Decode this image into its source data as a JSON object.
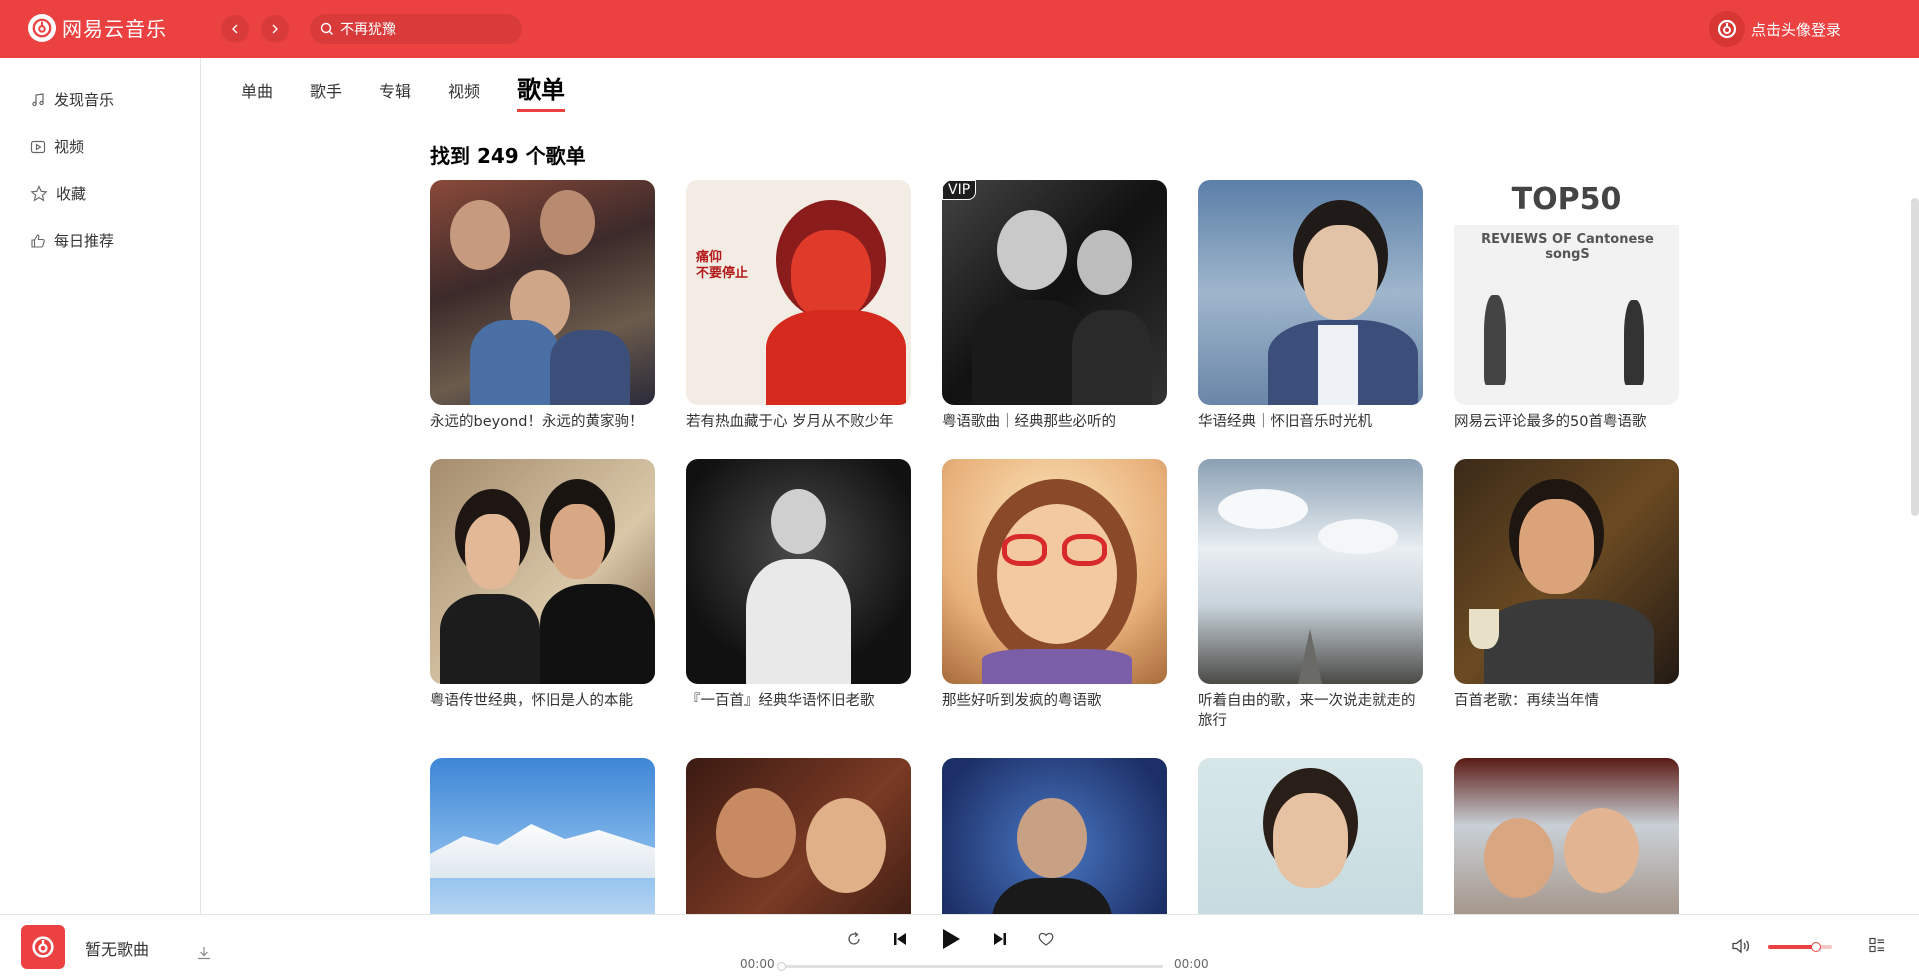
{
  "app": {
    "title": "网易云音乐",
    "brand_color": "#ec4141"
  },
  "header": {
    "back_icon": "chevron-left-icon",
    "forward_icon": "chevron-right-icon",
    "search_value": "不再犹豫",
    "login_label": "点击头像登录"
  },
  "sidebar": {
    "items": [
      {
        "label": "发现音乐",
        "icon": "music-note-icon"
      },
      {
        "label": "视频",
        "icon": "video-icon"
      },
      {
        "label": "收藏",
        "icon": "star-icon"
      },
      {
        "label": "每日推荐",
        "icon": "thumbs-up-icon"
      }
    ]
  },
  "tabs": [
    {
      "label": "单曲",
      "active": false
    },
    {
      "label": "歌手",
      "active": false
    },
    {
      "label": "专辑",
      "active": false
    },
    {
      "label": "视频",
      "active": false
    },
    {
      "label": "歌单",
      "active": true
    }
  ],
  "results": {
    "title": "找到 249 个歌单",
    "playlists": [
      {
        "title": "永远的beyond！永远的黄家驹！",
        "cover": "band-photo"
      },
      {
        "title": "若有热血藏于心 岁月从不败少年",
        "cover": "red-art"
      },
      {
        "title": "粤语歌曲｜经典那些必听的",
        "cover": "bw-couple",
        "badge": "VIP"
      },
      {
        "title": "华语经典｜怀旧音乐时光机",
        "cover": "portrait-blue"
      },
      {
        "title": "网易云评论最多的50首粤语歌",
        "cover": "top50",
        "cover_text_1": "TOP50",
        "cover_text_2": "REVIEWS OF Cantonese songS"
      },
      {
        "title": "粤语传世经典，怀旧是人的本能",
        "cover": "couple-photo"
      },
      {
        "title": "『一百首』经典华语怀旧老歌",
        "cover": "bw-singer"
      },
      {
        "title": "那些好听到发疯的粤语歌",
        "cover": "cartoon-girl"
      },
      {
        "title": "听着自由的歌，来一次说走就走的旅行",
        "cover": "sky-road"
      },
      {
        "title": "百首老歌：再续当年情",
        "cover": "man-wine"
      },
      {
        "title": "",
        "cover": "snow-mountain"
      },
      {
        "title": "",
        "cover": "film-couple"
      },
      {
        "title": "",
        "cover": "concert-singer"
      },
      {
        "title": "",
        "cover": "portrait-light"
      },
      {
        "title": "",
        "cover": "train-photo"
      }
    ]
  },
  "player": {
    "song_name": "暂无歌曲",
    "current_time": "00:00",
    "total_time": "00:00",
    "progress": 0,
    "volume": 0.75
  }
}
